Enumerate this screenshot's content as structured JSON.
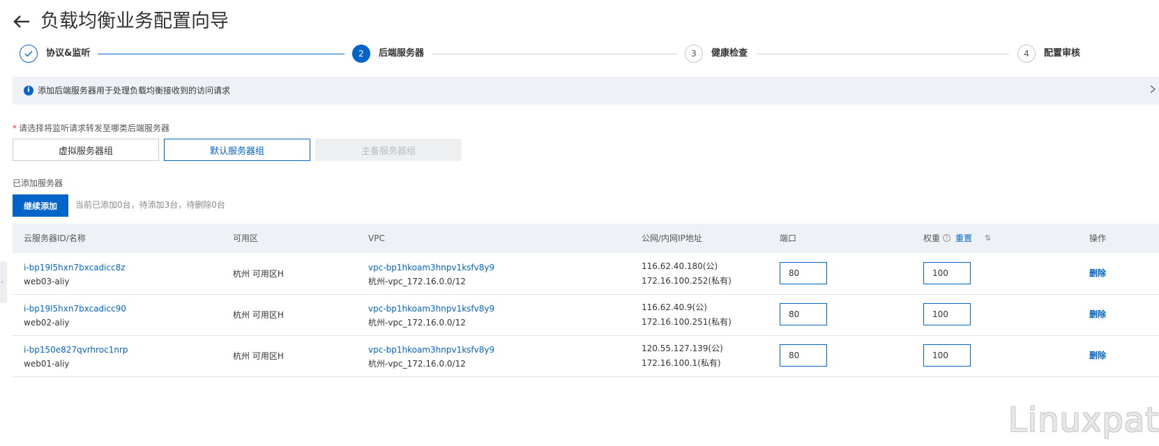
{
  "header": {
    "back_icon": "arrow-left-icon",
    "title": "负载均衡业务配置向导"
  },
  "steps": [
    {
      "number": "",
      "label": "协议&监听",
      "status": "done"
    },
    {
      "number": "2",
      "label": "后端服务器",
      "status": "active"
    },
    {
      "number": "3",
      "label": "健康检查",
      "status": "pending"
    },
    {
      "number": "4",
      "label": "配置审核",
      "status": "pending"
    }
  ],
  "info_bar": {
    "icon": "info-icon",
    "text": "添加后端服务器用于处理负载均衡接收到的访问请求"
  },
  "server_type": {
    "required_mark": "*",
    "label": "请选择将监听请求转发至哪类后端服务器",
    "options": [
      {
        "label": "虚拟服务器组",
        "state": "normal"
      },
      {
        "label": "默认服务器组",
        "state": "selected"
      },
      {
        "label": "主备服务器组",
        "state": "disabled"
      }
    ]
  },
  "added_servers": {
    "label": "已添加服务器",
    "continue_button": "继续添加",
    "summary": "当前已添加0台，待添加3台，待删除0台"
  },
  "table": {
    "columns": {
      "server": "云服务器ID/名称",
      "zone": "可用区",
      "vpc": "VPC",
      "ip": "公网/内网IP地址",
      "port": "端口",
      "weight": "权重",
      "weight_reset": "重置",
      "actions": "操作"
    },
    "rows": [
      {
        "server_id": "i-bp19l5hxn7bxcadicc8z",
        "server_name": "web03-aliy",
        "zone": "杭州 可用区H",
        "vpc_id": "vpc-bp1hkoam3hnpv1ksfv8y9",
        "vpc_name": "杭州-vpc_172.16.0.0/12",
        "public_ip": "116.62.40.180(公)",
        "private_ip": "172.16.100.252(私有)",
        "port": "80",
        "weight": "100",
        "action": "删除"
      },
      {
        "server_id": "i-bp19l5hxn7bxcadicc90",
        "server_name": "web02-aliy",
        "zone": "杭州 可用区H",
        "vpc_id": "vpc-bp1hkoam3hnpv1ksfv8y9",
        "vpc_name": "杭州-vpc_172.16.0.0/12",
        "public_ip": "116.62.40.9(公)",
        "private_ip": "172.16.100.251(私有)",
        "port": "80",
        "weight": "100",
        "action": "删除"
      },
      {
        "server_id": "i-bp150e827qvrhroc1nrp",
        "server_name": "web01-aliy",
        "zone": "杭州 可用区H",
        "vpc_id": "vpc-bp1hkoam3hnpv1ksfv8y9",
        "vpc_name": "杭州-vpc_172.16.0.0/12",
        "public_ip": "120.55.127.139(公)",
        "private_ip": "172.16.100.1(私有)",
        "port": "80",
        "weight": "100",
        "action": "删除"
      }
    ]
  },
  "watermark": "Linuxpath",
  "colors": {
    "primary": "#0064c8",
    "header_bg": "#eef1f5",
    "required": "#e42e2e"
  }
}
